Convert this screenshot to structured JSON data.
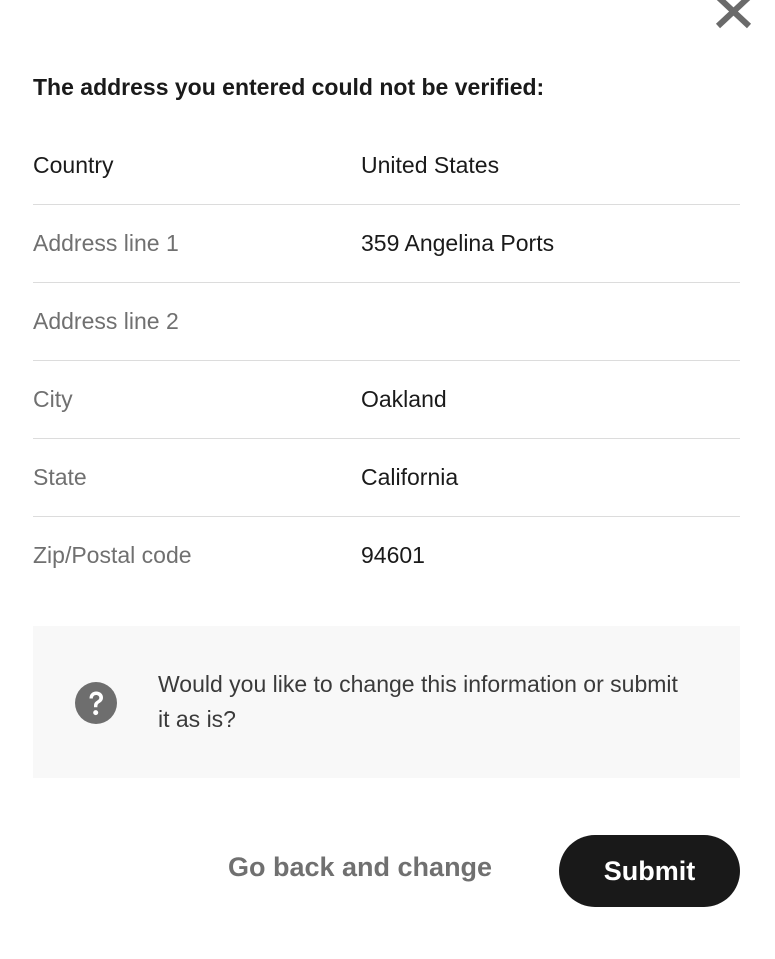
{
  "dialog": {
    "close_icon": "close-icon",
    "heading": "The address you entered could not be verified:"
  },
  "address": {
    "rows": [
      {
        "label": "Country",
        "value": "United States"
      },
      {
        "label": "Address line 1",
        "value": "359 Angelina Ports"
      },
      {
        "label": "Address line 2",
        "value": ""
      },
      {
        "label": "City",
        "value": "Oakland"
      },
      {
        "label": "State",
        "value": "California"
      },
      {
        "label": "Zip/Postal code",
        "value": "94601"
      }
    ]
  },
  "notice": {
    "icon": "question-circle-icon",
    "text": "Would you like to change this information or submit it as is?"
  },
  "actions": {
    "back_label": "Go back and change",
    "submit_label": "Submit"
  },
  "colors": {
    "primary_button": "#191919",
    "secondary_text": "#707070",
    "notice_background": "#f8f8f8"
  }
}
